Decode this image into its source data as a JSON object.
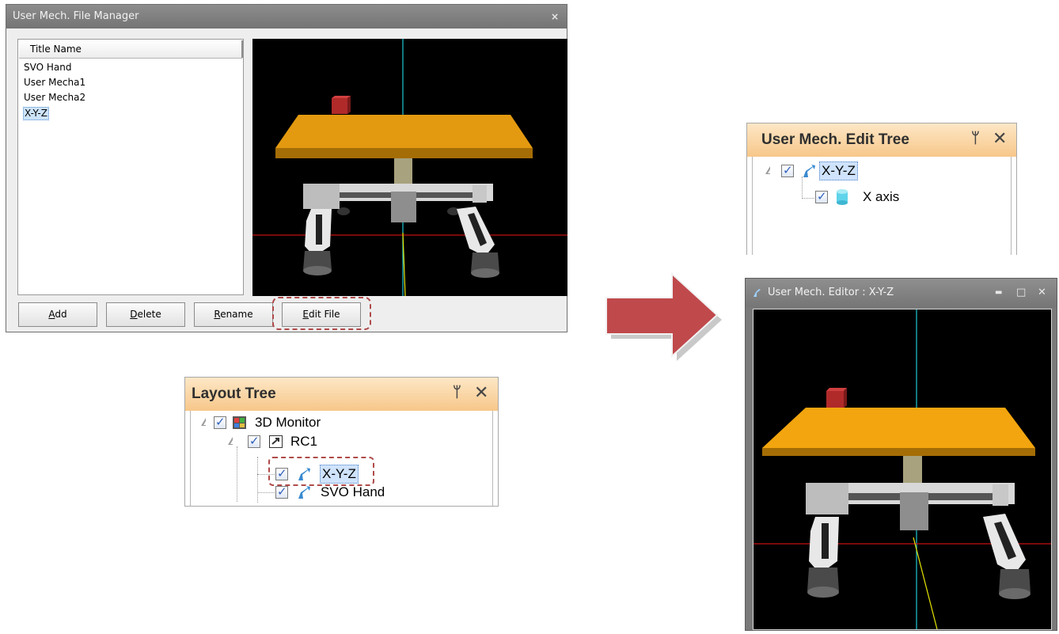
{
  "file_manager": {
    "title": "User Mech. File Manager",
    "close_glyph": "×",
    "list_header": "Title Name",
    "items": [
      "SVO Hand",
      "User Mecha1",
      "User Mecha2",
      "X-Y-Z"
    ],
    "selected_item": "X-Y-Z",
    "buttons": {
      "add_key": "A",
      "add_rest": "dd",
      "delete_key": "D",
      "delete_rest": "elete",
      "rename_key": "R",
      "rename_rest": "ename",
      "edit_key": "E",
      "edit_rest": "dit File"
    }
  },
  "layout_tree": {
    "title": "Layout Tree",
    "pin_glyph": "ᛘ",
    "close_glyph": "✕",
    "nodes": {
      "monitor": "3D Monitor",
      "rc1": "RC1",
      "xyz": "X-Y-Z",
      "svo": "SVO Hand"
    }
  },
  "edit_tree": {
    "title": "User Mech. Edit Tree",
    "pin_glyph": "ᛘ",
    "close_glyph": "✕",
    "nodes": {
      "root": "X-Y-Z",
      "axis": "X axis"
    }
  },
  "editor": {
    "title": "User Mech. Editor : X-Y-Z",
    "minimize_glyph": "▬",
    "maximize_glyph": "□",
    "close_glyph": "✕"
  },
  "colors": {
    "table_top": "#e39a10",
    "table_edge": "#a56d06",
    "marker_cube": "#b02a2a",
    "axis_cyan": "#1fc9d6",
    "axis_red": "#c41010",
    "axis_yellow": "#e6e600",
    "arrow_red": "#c0494c",
    "panel_header": "#f7c78a"
  }
}
